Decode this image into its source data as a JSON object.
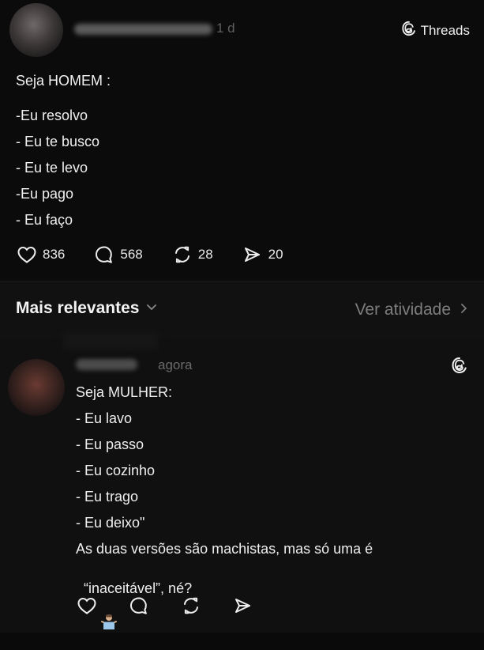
{
  "post": {
    "time": "1 d",
    "brand_label": "Threads",
    "lines": [
      "Seja HOMEM :",
      "-Eu resolvo",
      "- Eu te busco",
      "- Eu te levo",
      "-Eu pago",
      "- Eu faço"
    ],
    "counts": {
      "likes": "836",
      "replies": "568",
      "reposts": "28",
      "shares": "20"
    }
  },
  "sort_bar": {
    "label": "Mais relevantes",
    "view_activity": "Ver atividade"
  },
  "comment": {
    "time": "agora",
    "lines": [
      "Seja MULHER:",
      "- Eu lavo",
      "- Eu passo",
      "- Eu cozinho",
      "- Eu trago",
      "- Eu deixo\"",
      "As duas versões são machistas, mas só uma é"
    ],
    "last_line": "“inaceitável”, né?"
  },
  "icons": {
    "brand": "threads-icon",
    "like": "heart-icon",
    "reply": "comment-icon",
    "repost": "repost-icon",
    "share": "send-icon",
    "chevron": "chevron-down-icon",
    "arrow": "chevron-right-icon",
    "emoji": "person-shrugging-emoji"
  }
}
